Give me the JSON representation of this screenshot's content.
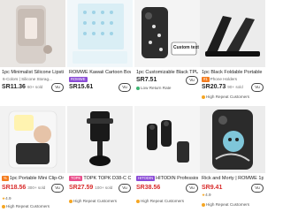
{
  "products": [
    {
      "title": "1pc Minimalist Silicone Lipstick Hold...",
      "badge": "",
      "tag": "6-Colors | Silicone Storag...",
      "price": "SR11.36",
      "sold": "60+ sold",
      "note": "",
      "btn": "Vu"
    },
    {
      "title": "ROMWE Kawaii Cartoon Bow Anti...",
      "badge": "ROMWE",
      "tag": "",
      "price": "SR15.61",
      "sold": "",
      "note": "",
      "btn": "Vu"
    },
    {
      "title": "1pc Customizable Black TPU Pho...",
      "badge": "",
      "tag": "",
      "price": "SR7.51",
      "sold": "",
      "note": "Low Return Rate",
      "btn": "Vu",
      "custom_text": "Custom text"
    },
    {
      "title": "1pc Black Foldable Portable Phon...",
      "badge": "",
      "tag": "Phone Holders",
      "price": "SR20.73",
      "sold": "90+ sold",
      "note": "High Repeat Customers",
      "btn": "Vu"
    },
    {
      "title": "1pc Portable Mini Clip-On Fill L...",
      "badge": "",
      "tag": "",
      "price": "SR18.56",
      "sold": "300+ sold",
      "note": "High Repeat Customers",
      "btn": "Vu",
      "rating": "4.9"
    },
    {
      "title": "TOPK TOPK D38-C Car Pho...",
      "badge": "TOPK",
      "tag": "",
      "price": "SR27.59",
      "sold": "100+ sold",
      "note": "High Repeat Customers",
      "btn": "Vu"
    },
    {
      "title": "HITODIN Professional Wirel...",
      "badge": "HITODIN",
      "tag": "",
      "price": "SR38.56",
      "sold": "",
      "note": "High Repeat Customers",
      "btn": "Vu"
    },
    {
      "title": "Rick and Morty | ROMWE 1pc...",
      "badge": "",
      "tag": "",
      "price": "SR9.41",
      "sold": "",
      "note": "High Repeat Customers",
      "btn": "Vu",
      "rating": "4.9"
    }
  ],
  "colors": {
    "accent": "#d82b2b",
    "star": "#f5a623",
    "brand_purple": "#8a4bd6",
    "brand_orange": "#f47c1f"
  }
}
